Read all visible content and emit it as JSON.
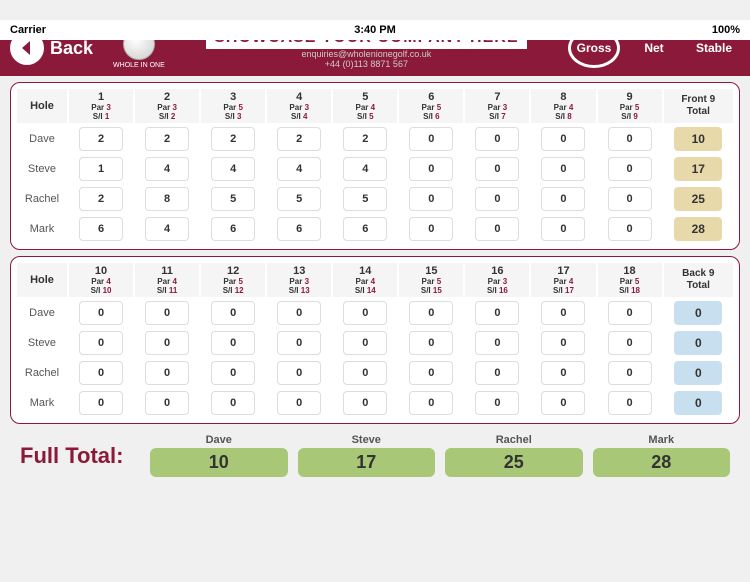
{
  "status_bar": {
    "carrier": "Carrier",
    "wifi_icon": "wifi",
    "time": "3:40 PM",
    "battery": "100%"
  },
  "header": {
    "back_label": "Back",
    "company_name": "SHOWCASE YOUR COMPANY HERE",
    "company_sub1": "enquiries@wholenionegolf.co.uk",
    "company_sub2": "+44 (0)113 8871 567",
    "nav_gross": "Gross",
    "nav_net": "Net",
    "nav_stable": "Stable"
  },
  "front9": {
    "section_label": "Front 9",
    "total_label": "Total",
    "holes": [
      {
        "num": "1",
        "par": "3",
        "si": "1"
      },
      {
        "num": "2",
        "par": "3",
        "si": "2"
      },
      {
        "num": "3",
        "par": "5",
        "si": "3"
      },
      {
        "num": "4",
        "par": "3",
        "si": "4"
      },
      {
        "num": "5",
        "par": "4",
        "si": "5"
      },
      {
        "num": "6",
        "par": "5",
        "si": "6"
      },
      {
        "num": "7",
        "par": "3",
        "si": "7"
      },
      {
        "num": "8",
        "par": "4",
        "si": "8"
      },
      {
        "num": "9",
        "par": "5",
        "si": "9"
      }
    ],
    "players": [
      {
        "name": "Dave",
        "scores": [
          "2",
          "2",
          "2",
          "2",
          "2",
          "0",
          "0",
          "0",
          "0"
        ],
        "total": "10"
      },
      {
        "name": "Steve",
        "scores": [
          "1",
          "4",
          "4",
          "4",
          "4",
          "0",
          "0",
          "0",
          "0"
        ],
        "total": "17"
      },
      {
        "name": "Rachel",
        "scores": [
          "2",
          "8",
          "5",
          "5",
          "5",
          "0",
          "0",
          "0",
          "0"
        ],
        "total": "25"
      },
      {
        "name": "Mark",
        "scores": [
          "6",
          "4",
          "6",
          "6",
          "6",
          "0",
          "0",
          "0",
          "0"
        ],
        "total": "28"
      }
    ]
  },
  "back9": {
    "section_label": "Back 9",
    "total_label": "Total",
    "holes": [
      {
        "num": "10",
        "par": "4",
        "si": "10"
      },
      {
        "num": "11",
        "par": "4",
        "si": "11"
      },
      {
        "num": "12",
        "par": "5",
        "si": "12"
      },
      {
        "num": "13",
        "par": "3",
        "si": "13"
      },
      {
        "num": "14",
        "par": "4",
        "si": "14"
      },
      {
        "num": "15",
        "par": "5",
        "si": "15"
      },
      {
        "num": "16",
        "par": "3",
        "si": "16"
      },
      {
        "num": "17",
        "par": "4",
        "si": "17"
      },
      {
        "num": "18",
        "par": "5",
        "si": "18"
      }
    ],
    "players": [
      {
        "name": "Dave",
        "scores": [
          "0",
          "0",
          "0",
          "0",
          "0",
          "0",
          "0",
          "0",
          "0"
        ],
        "total": "0"
      },
      {
        "name": "Steve",
        "scores": [
          "0",
          "0",
          "0",
          "0",
          "0",
          "0",
          "0",
          "0",
          "0"
        ],
        "total": "0"
      },
      {
        "name": "Rachel",
        "scores": [
          "0",
          "0",
          "0",
          "0",
          "0",
          "0",
          "0",
          "0",
          "0"
        ],
        "total": "0"
      },
      {
        "name": "Mark",
        "scores": [
          "0",
          "0",
          "0",
          "0",
          "0",
          "0",
          "0",
          "0",
          "0"
        ],
        "total": "0"
      }
    ]
  },
  "full_total": {
    "label": "Full Total:",
    "players": [
      {
        "name": "Dave",
        "total": "10"
      },
      {
        "name": "Steve",
        "total": "17"
      },
      {
        "name": "Rachel",
        "total": "25"
      },
      {
        "name": "Mark",
        "total": "28"
      }
    ]
  }
}
